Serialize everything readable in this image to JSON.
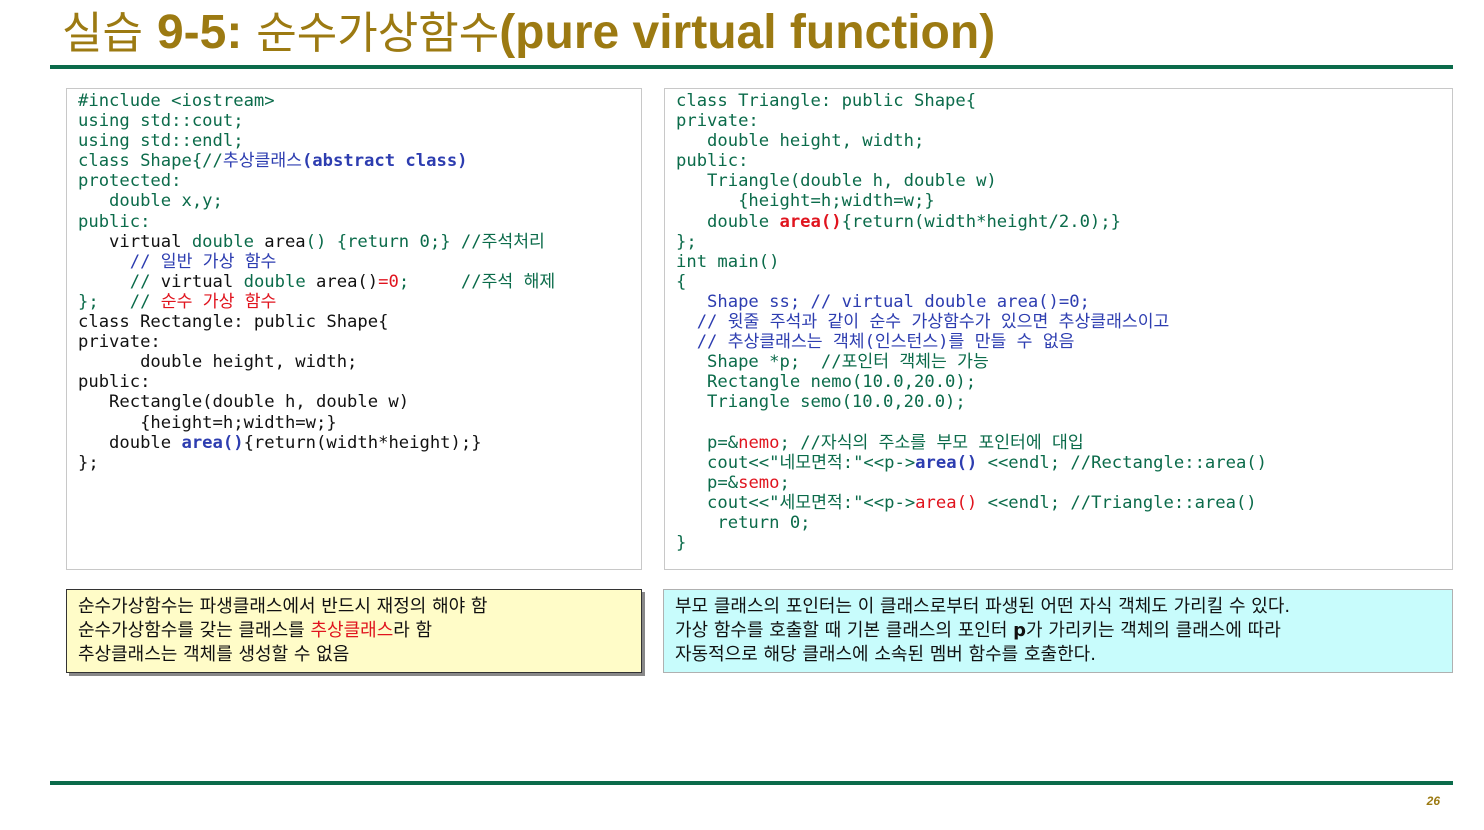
{
  "title": {
    "prefix": "실습 ",
    "number": "9-5:",
    "korean": " 순수가상함수",
    "english": "(pure virtual function)"
  },
  "page_number": "26",
  "code_left": [
    [
      {
        "t": "#include <iostream>",
        "c": "g"
      }
    ],
    [
      {
        "t": "using std::cout;",
        "c": "g"
      }
    ],
    [
      {
        "t": "using std::endl;",
        "c": "g"
      }
    ],
    [
      {
        "t": "class Shape{//",
        "c": "g"
      },
      {
        "t": "추상클래스",
        "c": "b"
      },
      {
        "t": "(abstract class)",
        "c": "bb"
      }
    ],
    [
      {
        "t": "protected:",
        "c": "g"
      }
    ],
    [
      {
        "t": "   double x,y;",
        "c": "g"
      }
    ],
    [
      {
        "t": "public:",
        "c": "g"
      }
    ],
    [
      {
        "t": "   virtual ",
        "c": "k"
      },
      {
        "t": "double ",
        "c": "g"
      },
      {
        "t": "area",
        "c": "k"
      },
      {
        "t": "() {return 0;} //주석처리",
        "c": "g"
      }
    ],
    [
      {
        "t": "     // 일반 가상 함수",
        "c": "b"
      }
    ],
    [
      {
        "t": "     // ",
        "c": "g"
      },
      {
        "t": "virtual ",
        "c": "k"
      },
      {
        "t": "double ",
        "c": "g"
      },
      {
        "t": "area()",
        "c": "k"
      },
      {
        "t": "=0",
        "c": "r"
      },
      {
        "t": ";     //주석 해제",
        "c": "g"
      }
    ],
    [
      {
        "t": "};   // ",
        "c": "g"
      },
      {
        "t": "순수 가상 함수",
        "c": "r"
      }
    ],
    [
      {
        "t": "class Rectangle: public Shape{",
        "c": "k"
      }
    ],
    [
      {
        "t": "private:",
        "c": "k"
      }
    ],
    [
      {
        "t": "      double height, width;",
        "c": "k"
      }
    ],
    [
      {
        "t": "public:",
        "c": "k"
      }
    ],
    [
      {
        "t": "   Rectangle(double h, double w)",
        "c": "k"
      }
    ],
    [
      {
        "t": "      {height=h;width=w;}",
        "c": "k"
      }
    ],
    [
      {
        "t": "   double ",
        "c": "k"
      },
      {
        "t": "area()",
        "c": "bb"
      },
      {
        "t": "{return(width*height);}",
        "c": "k"
      }
    ],
    [
      {
        "t": "};",
        "c": "k"
      }
    ]
  ],
  "code_right": [
    [
      {
        "t": "class Triangle: public Shape{",
        "c": "g"
      }
    ],
    [
      {
        "t": "private:",
        "c": "g"
      }
    ],
    [
      {
        "t": "   double height, width;",
        "c": "g"
      }
    ],
    [
      {
        "t": "public:",
        "c": "g"
      }
    ],
    [
      {
        "t": "   Triangle(double h, double w)",
        "c": "g"
      }
    ],
    [
      {
        "t": "      {height=h;width=w;}",
        "c": "g"
      }
    ],
    [
      {
        "t": "   double ",
        "c": "g"
      },
      {
        "t": "area()",
        "c": "rb"
      },
      {
        "t": "{return(width*height/2.0);}",
        "c": "g"
      }
    ],
    [
      {
        "t": "};",
        "c": "g"
      }
    ],
    [
      {
        "t": "int main()",
        "c": "g"
      }
    ],
    [
      {
        "t": "{",
        "c": "g"
      }
    ],
    [
      {
        "t": "   Shape ss; // virtual double area()=0;",
        "c": "b"
      }
    ],
    [
      {
        "t": "  // 윗줄 주석과 같이 순수 가상함수가 있으면 추상클래스이고",
        "c": "b"
      }
    ],
    [
      {
        "t": "  // 추상클래스는 객체(인스턴스)를 만들 수 없음",
        "c": "b"
      }
    ],
    [
      {
        "t": "   Shape *p;  //포인터 객체는 가능",
        "c": "g"
      }
    ],
    [
      {
        "t": "   Rectangle nemo(10.0,20.0);",
        "c": "g"
      }
    ],
    [
      {
        "t": "   Triangle semo(10.0,20.0);",
        "c": "g"
      }
    ],
    [
      {
        "t": "",
        "c": "g"
      }
    ],
    [
      {
        "t": "   p=&",
        "c": "g"
      },
      {
        "t": "nemo",
        "c": "r"
      },
      {
        "t": "; //자식의 주소를 부모 포인터에 대입",
        "c": "g"
      }
    ],
    [
      {
        "t": "   cout<<\"네모면적:\"<<p->",
        "c": "g"
      },
      {
        "t": "area()",
        "c": "bb"
      },
      {
        "t": " <<endl; //Rectangle::area()",
        "c": "g"
      }
    ],
    [
      {
        "t": "   p=&",
        "c": "g"
      },
      {
        "t": "semo",
        "c": "r"
      },
      {
        "t": ";",
        "c": "g"
      }
    ],
    [
      {
        "t": "   cout<<\"세모면적:\"<<p->",
        "c": "g"
      },
      {
        "t": "area()",
        "c": "r"
      },
      {
        "t": " <<endl; //Triangle::area()",
        "c": "g"
      }
    ],
    [
      {
        "t": "    return 0;",
        "c": "g"
      }
    ],
    [
      {
        "t": "}",
        "c": "g"
      }
    ]
  ],
  "note_left": {
    "line1": "순수가상함수는 파생클래스에서 반드시 재정의 해야 함",
    "line2_before": "순수가상함수를 갖는 클래스를 ",
    "line2_highlight": "추상클래스",
    "line2_after": "라 함",
    "line3": "추상클래스는 객체를 생성할  수 없음"
  },
  "note_right": {
    "line1": "부모 클래스의 포인터는 이 클래스로부터 파생된 어떤 자식 객체도 가리킬 수 있다.",
    "line2_before": "가상 함수를 호출할 때 기본 클래스의 포인터 ",
    "line2_var": "p",
    "line2_after": "가 가리키는 객체의 클래스에 따라",
    "line3": "자동적으로 해당 클래스에 소속된 멤버 함수를 호출한다."
  },
  "colors": {
    "title": "#9c7a12",
    "rule": "#0b6b4a",
    "code_green": "#0b6b4a",
    "code_blue": "#2d3db0",
    "code_red": "#e0141e",
    "note_left_bg": "#fffcc8",
    "note_right_bg": "#c8fcfc"
  }
}
